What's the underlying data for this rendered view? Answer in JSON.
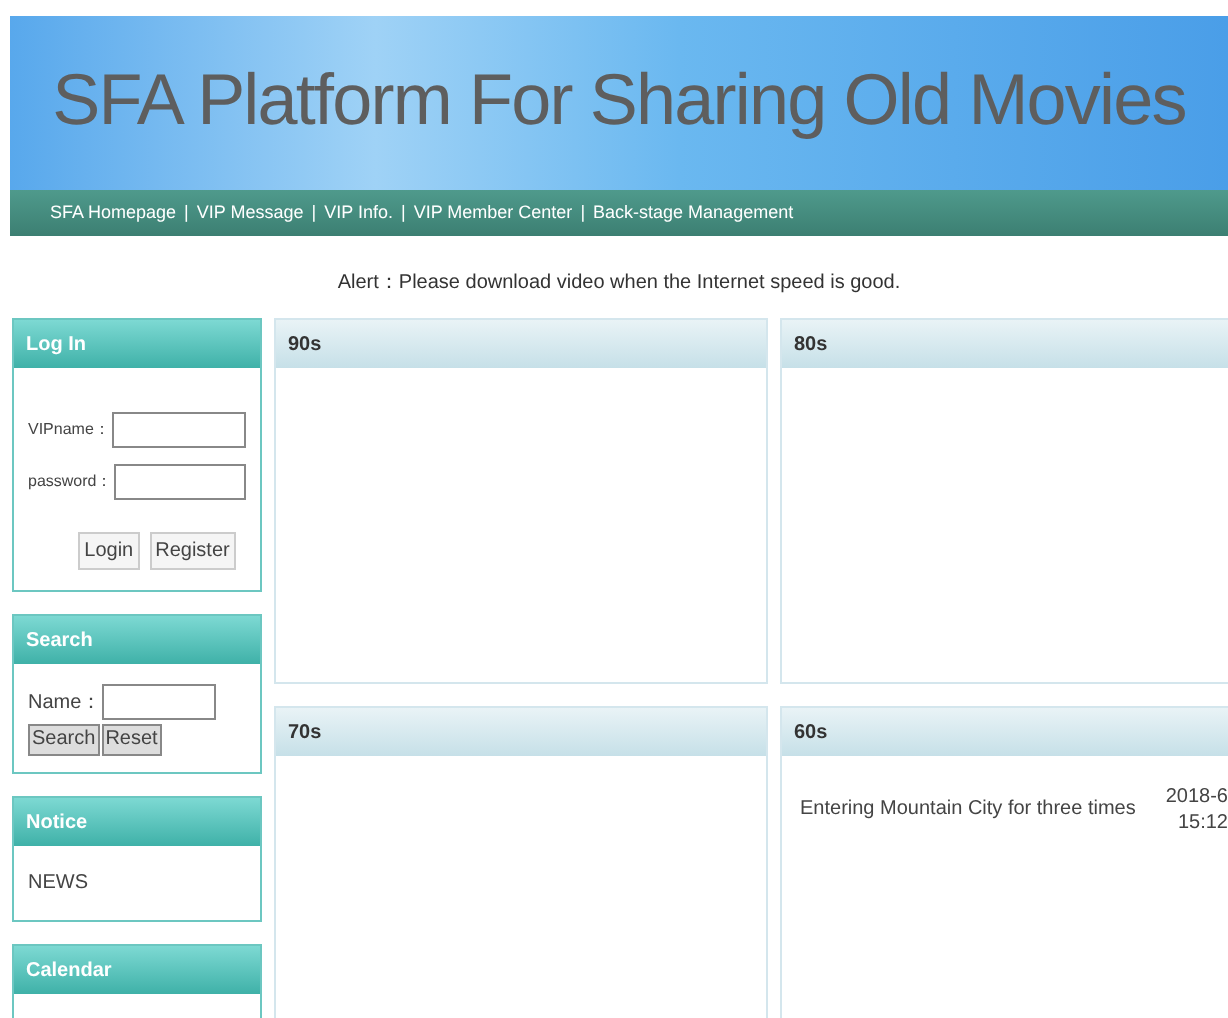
{
  "header": {
    "title": "SFA Platform For Sharing Old Movies"
  },
  "nav": {
    "items": [
      {
        "label": "SFA Homepage"
      },
      {
        "label": "VIP Message"
      },
      {
        "label": "VIP Info."
      },
      {
        "label": "VIP Member Center"
      },
      {
        "label": "Back-stage Management"
      }
    ],
    "separator": "|"
  },
  "alert": "Alert：Please download video when the Internet speed is good.",
  "sidebar": [
    {
      "kind": "login",
      "title": "Log In",
      "fields": [
        {
          "label": "VIPname："
        },
        {
          "label": "password："
        }
      ],
      "buttons": [
        "Login",
        "Register"
      ]
    },
    {
      "kind": "search",
      "title": "Search",
      "fields": [
        {
          "label": "Name："
        }
      ],
      "buttons": [
        "Search",
        "Reset"
      ]
    },
    {
      "kind": "notice",
      "title": "Notice",
      "text": "NEWS"
    },
    {
      "kind": "calendar",
      "title": "Calendar"
    }
  ],
  "sections": [
    {
      "title": "90s"
    },
    {
      "title": "80s"
    },
    {
      "title": "70s"
    },
    {
      "title": "60s",
      "items": [
        {
          "title": "Entering Mountain City for three times",
          "date": "2018-6",
          "time": "15:12"
        }
      ]
    }
  ]
}
